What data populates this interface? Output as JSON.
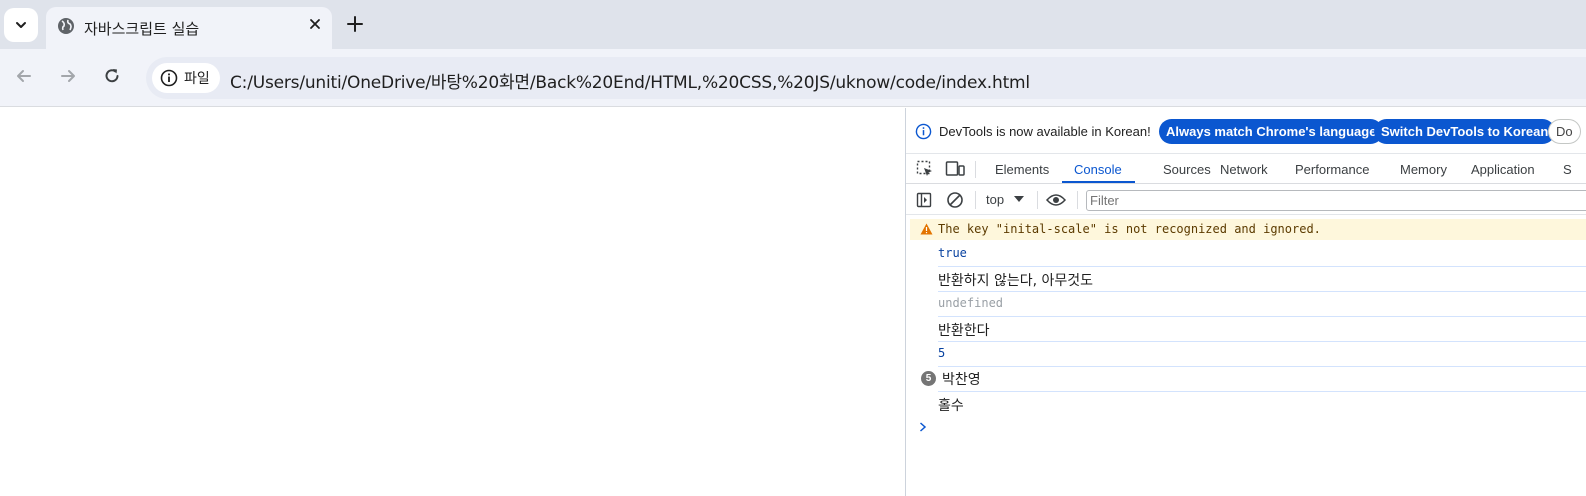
{
  "tab": {
    "title": "자바스크립트 실습"
  },
  "omnibox": {
    "site_chip": "파일",
    "url": "C:/Users/uniti/OneDrive/바탕%20화면/Back%20End/HTML,%20CSS,%20JS/uknow/code/index.html"
  },
  "devtools": {
    "infobar": {
      "message": "DevTools is now available in Korean!",
      "btn_always": "Always match Chrome's language",
      "btn_switch": "Switch DevTools to Korean",
      "btn_dont": "Do"
    },
    "tabs": [
      "Elements",
      "Console",
      "Sources",
      "Network",
      "Performance",
      "Memory",
      "Application",
      "S"
    ],
    "active_tab": "Console",
    "console": {
      "context": "top",
      "filter_placeholder": "Filter",
      "warning": "The key \"inital-scale\" is not recognized and ignored.",
      "logs": [
        {
          "text": "true",
          "kind": "boolean"
        },
        {
          "text": "반환하지 않는다, 아무것도",
          "kind": "string"
        },
        {
          "text": "undefined",
          "kind": "undefined"
        },
        {
          "text": "반환한다",
          "kind": "string"
        },
        {
          "text": "5",
          "kind": "number"
        },
        {
          "text": "박찬영",
          "kind": "string",
          "repeat": "5"
        },
        {
          "text": "홀수",
          "kind": "string"
        }
      ]
    }
  },
  "colors": {
    "accent": "#0b57d0",
    "warning_bg": "#fef7dc",
    "tabstrip": "#dfe3eb",
    "toolbar": "#f1f3f9"
  }
}
